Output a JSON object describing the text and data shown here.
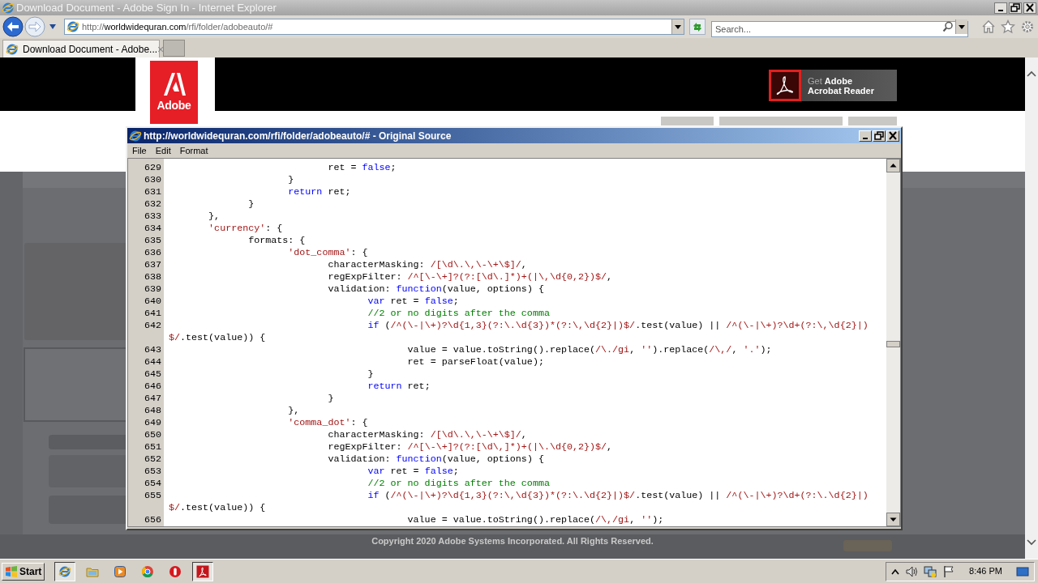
{
  "browser": {
    "title": "Download Document - Adobe Sign In - Internet Explorer",
    "address": {
      "scheme": "http://",
      "host": "worldwidequran.com",
      "path": "/rfi/folder/adobeauto/#"
    },
    "search": {
      "placeholder": "Search..."
    },
    "tabs": [
      {
        "label": "Download Document - Adobe...",
        "close": "×",
        "selected": true
      }
    ]
  },
  "page": {
    "logo": "Adobe",
    "promo": {
      "line1": "Get **Adobe**",
      "line2": "Acrobat Reader"
    },
    "copyright": "Copyright 2020 Adobe Systems Incorporated. All Rights Reserved."
  },
  "source_window": {
    "title": "http://worldwidequran.com/rfi/folder/adobeauto/# - Original Source",
    "menu": [
      "File",
      "Edit",
      "Format"
    ],
    "lines": [
      {
        "number": "629",
        "segments": [
          {
            "kind": "plain",
            "text": "\t\t\t\tret = "
          },
          {
            "kind": "keyword",
            "text": "false"
          },
          {
            "kind": "plain",
            "text": ";"
          }
        ]
      },
      {
        "number": "630",
        "segments": [
          {
            "kind": "plain",
            "text": "\t\t\t}"
          }
        ]
      },
      {
        "number": "631",
        "segments": [
          {
            "kind": "keyword",
            "text": "\t\t\treturn"
          },
          {
            "kind": "plain",
            "text": " ret;"
          }
        ]
      },
      {
        "number": "632",
        "segments": [
          {
            "kind": "plain",
            "text": "\t\t}"
          }
        ]
      },
      {
        "number": "633",
        "segments": [
          {
            "kind": "plain",
            "text": "\t},"
          }
        ]
      },
      {
        "number": "634",
        "segments": [
          {
            "kind": "string",
            "text": "\t'currency'"
          },
          {
            "kind": "plain",
            "text": ": {"
          }
        ]
      },
      {
        "number": "635",
        "segments": [
          {
            "kind": "plain",
            "text": "\t\tformats: {"
          }
        ]
      },
      {
        "number": "636",
        "segments": [
          {
            "kind": "string",
            "text": "\t\t\t'dot_comma'"
          },
          {
            "kind": "plain",
            "text": ": {"
          }
        ]
      },
      {
        "number": "637",
        "segments": [
          {
            "kind": "plain",
            "text": "\t\t\t\tcharacterMasking: "
          },
          {
            "kind": "string",
            "text": "/[\\d\\.\\,\\-\\+\\$]/"
          },
          {
            "kind": "plain",
            "text": ","
          }
        ]
      },
      {
        "number": "638",
        "segments": [
          {
            "kind": "plain",
            "text": "\t\t\t\tregExpFilter: "
          },
          {
            "kind": "string",
            "text": "/^[\\-\\+]?(?:[\\d\\.]*)+(|\\,\\d{0,2})$/"
          },
          {
            "kind": "plain",
            "text": ","
          }
        ]
      },
      {
        "number": "639",
        "segments": [
          {
            "kind": "plain",
            "text": "\t\t\t\tvalidation: "
          },
          {
            "kind": "keyword",
            "text": "function"
          },
          {
            "kind": "plain",
            "text": "(value, options) {"
          }
        ]
      },
      {
        "number": "640",
        "segments": [
          {
            "kind": "keyword",
            "text": "\t\t\t\t\tvar"
          },
          {
            "kind": "plain",
            "text": " ret = "
          },
          {
            "kind": "keyword",
            "text": "false"
          },
          {
            "kind": "plain",
            "text": ";"
          }
        ]
      },
      {
        "number": "641",
        "segments": [
          {
            "kind": "comment",
            "text": "\t\t\t\t\t//2 or no digits after the comma"
          }
        ]
      },
      {
        "number": "642",
        "segments": [
          {
            "kind": "keyword",
            "text": "\t\t\t\t\tif"
          },
          {
            "kind": "plain",
            "text": " ("
          },
          {
            "kind": "string",
            "text": "/^(\\-|\\+)?\\d{1,3}(?:\\.\\d{3})*(?:\\,\\d{2}|)$/"
          },
          {
            "kind": "plain",
            "text": ".test(value) || "
          },
          {
            "kind": "string",
            "text": "/^(\\-|\\+)?\\d+(?:\\,\\d{2}|)"
          }
        ],
        "wrap": [
          {
            "kind": "string",
            "text": "$/"
          },
          {
            "kind": "plain",
            "text": ".test(value)) {"
          }
        ]
      },
      {
        "number": "643",
        "segments": [
          {
            "kind": "plain",
            "text": "\t\t\t\t\t\tvalue = value.toString().replace("
          },
          {
            "kind": "string",
            "text": "/\\./gi"
          },
          {
            "kind": "plain",
            "text": ", "
          },
          {
            "kind": "string",
            "text": "''"
          },
          {
            "kind": "plain",
            "text": ").replace("
          },
          {
            "kind": "string",
            "text": "/\\,/"
          },
          {
            "kind": "plain",
            "text": ", "
          },
          {
            "kind": "string",
            "text": "'.'"
          },
          {
            "kind": "plain",
            "text": ");"
          }
        ]
      },
      {
        "number": "644",
        "segments": [
          {
            "kind": "plain",
            "text": "\t\t\t\t\t\tret = parseFloat(value);"
          }
        ]
      },
      {
        "number": "645",
        "segments": [
          {
            "kind": "plain",
            "text": "\t\t\t\t\t}"
          }
        ]
      },
      {
        "number": "646",
        "segments": [
          {
            "kind": "keyword",
            "text": "\t\t\t\t\treturn"
          },
          {
            "kind": "plain",
            "text": " ret;"
          }
        ]
      },
      {
        "number": "647",
        "segments": [
          {
            "kind": "plain",
            "text": "\t\t\t\t}"
          }
        ]
      },
      {
        "number": "648",
        "segments": [
          {
            "kind": "plain",
            "text": "\t\t\t},"
          }
        ]
      },
      {
        "number": "649",
        "segments": [
          {
            "kind": "string",
            "text": "\t\t\t'comma_dot'"
          },
          {
            "kind": "plain",
            "text": ": {"
          }
        ]
      },
      {
        "number": "650",
        "segments": [
          {
            "kind": "plain",
            "text": "\t\t\t\tcharacterMasking: "
          },
          {
            "kind": "string",
            "text": "/[\\d\\.\\,\\-\\+\\$]/"
          },
          {
            "kind": "plain",
            "text": ","
          }
        ]
      },
      {
        "number": "651",
        "segments": [
          {
            "kind": "plain",
            "text": "\t\t\t\tregExpFilter: "
          },
          {
            "kind": "string",
            "text": "/^[\\-\\+]?(?:[\\d\\,]*)+(|\\.\\d{0,2})$/"
          },
          {
            "kind": "plain",
            "text": ","
          }
        ]
      },
      {
        "number": "652",
        "segments": [
          {
            "kind": "plain",
            "text": "\t\t\t\tvalidation: "
          },
          {
            "kind": "keyword",
            "text": "function"
          },
          {
            "kind": "plain",
            "text": "(value, options) {"
          }
        ]
      },
      {
        "number": "653",
        "segments": [
          {
            "kind": "keyword",
            "text": "\t\t\t\t\tvar"
          },
          {
            "kind": "plain",
            "text": " ret = "
          },
          {
            "kind": "keyword",
            "text": "false"
          },
          {
            "kind": "plain",
            "text": ";"
          }
        ]
      },
      {
        "number": "654",
        "segments": [
          {
            "kind": "comment",
            "text": "\t\t\t\t\t//2 or no digits after the comma"
          }
        ]
      },
      {
        "number": "655",
        "segments": [
          {
            "kind": "keyword",
            "text": "\t\t\t\t\tif"
          },
          {
            "kind": "plain",
            "text": " ("
          },
          {
            "kind": "string",
            "text": "/^(\\-|\\+)?\\d{1,3}(?:\\,\\d{3})*(?:\\.\\d{2}|)$/"
          },
          {
            "kind": "plain",
            "text": ".test(value) || "
          },
          {
            "kind": "string",
            "text": "/^(\\-|\\+)?\\d+(?:\\.\\d{2}|)"
          }
        ],
        "wrap": [
          {
            "kind": "string",
            "text": "$/"
          },
          {
            "kind": "plain",
            "text": ".test(value)) {"
          }
        ]
      },
      {
        "number": "656",
        "segments": [
          {
            "kind": "plain",
            "text": "\t\t\t\t\t\tvalue = value.toString().replace("
          },
          {
            "kind": "string",
            "text": "/\\,/gi"
          },
          {
            "kind": "plain",
            "text": ", "
          },
          {
            "kind": "string",
            "text": "''"
          },
          {
            "kind": "plain",
            "text": ");"
          }
        ]
      }
    ]
  },
  "taskbar": {
    "start": "Start",
    "items": [
      {
        "kind": "ie",
        "selected": true
      },
      {
        "kind": "folder",
        "selected": false
      },
      {
        "kind": "media",
        "selected": false
      },
      {
        "kind": "chrome",
        "selected": false
      },
      {
        "kind": "redcircle",
        "selected": false
      },
      {
        "kind": "acrobat",
        "selected": true
      }
    ],
    "clock": "8:46 PM"
  }
}
